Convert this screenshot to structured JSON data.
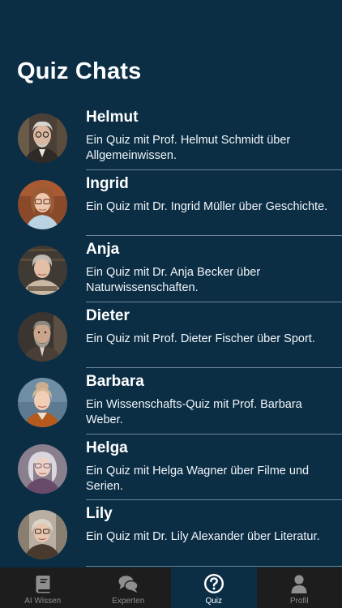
{
  "header": {
    "title": "Quiz Chats"
  },
  "chats": [
    {
      "name": "Helmut",
      "description": "Ein Quiz mit Prof. Helmut Schmidt über Allgemeinwissen.",
      "avatar_icon": "elderly-man-avatar"
    },
    {
      "name": "Ingrid",
      "description": "Ein Quiz mit Dr. Ingrid Müller über Geschichte.",
      "avatar_icon": "woman-glasses-avatar"
    },
    {
      "name": "Anja",
      "description": "Ein Quiz mit Dr. Anja Becker über Naturwissenschaften.",
      "avatar_icon": "grey-haired-woman-avatar"
    },
    {
      "name": "Dieter",
      "description": "Ein Quiz mit Prof. Dieter Fischer über Sport.",
      "avatar_icon": "bearded-man-avatar"
    },
    {
      "name": "Barbara",
      "description": "Ein Wissenschafts-Quiz mit Prof. Barbara Weber.",
      "avatar_icon": "woman-updo-avatar"
    },
    {
      "name": "Helga",
      "description": "Ein Quiz mit Helga Wagner über Filme und Serien.",
      "avatar_icon": "silver-haired-woman-avatar"
    },
    {
      "name": "Lily",
      "description": "Ein Quiz mit Dr. Lily Alexander über Literatur.",
      "avatar_icon": "woman-library-avatar"
    }
  ],
  "tab_bar": {
    "active": "Quiz",
    "tabs": [
      {
        "label": "AI Wissen",
        "icon": "book-icon"
      },
      {
        "label": "Experten",
        "icon": "chat-bubbles-icon"
      },
      {
        "label": "Quiz",
        "icon": "question-circle-icon"
      },
      {
        "label": "Profil",
        "icon": "person-icon"
      }
    ]
  },
  "colors": {
    "background": "#0b2e45",
    "tab_bar_background": "#1d1d1d",
    "tab_inactive": "#8f8f8f",
    "tab_active": "#ffffff",
    "divider": "#6b8394"
  }
}
